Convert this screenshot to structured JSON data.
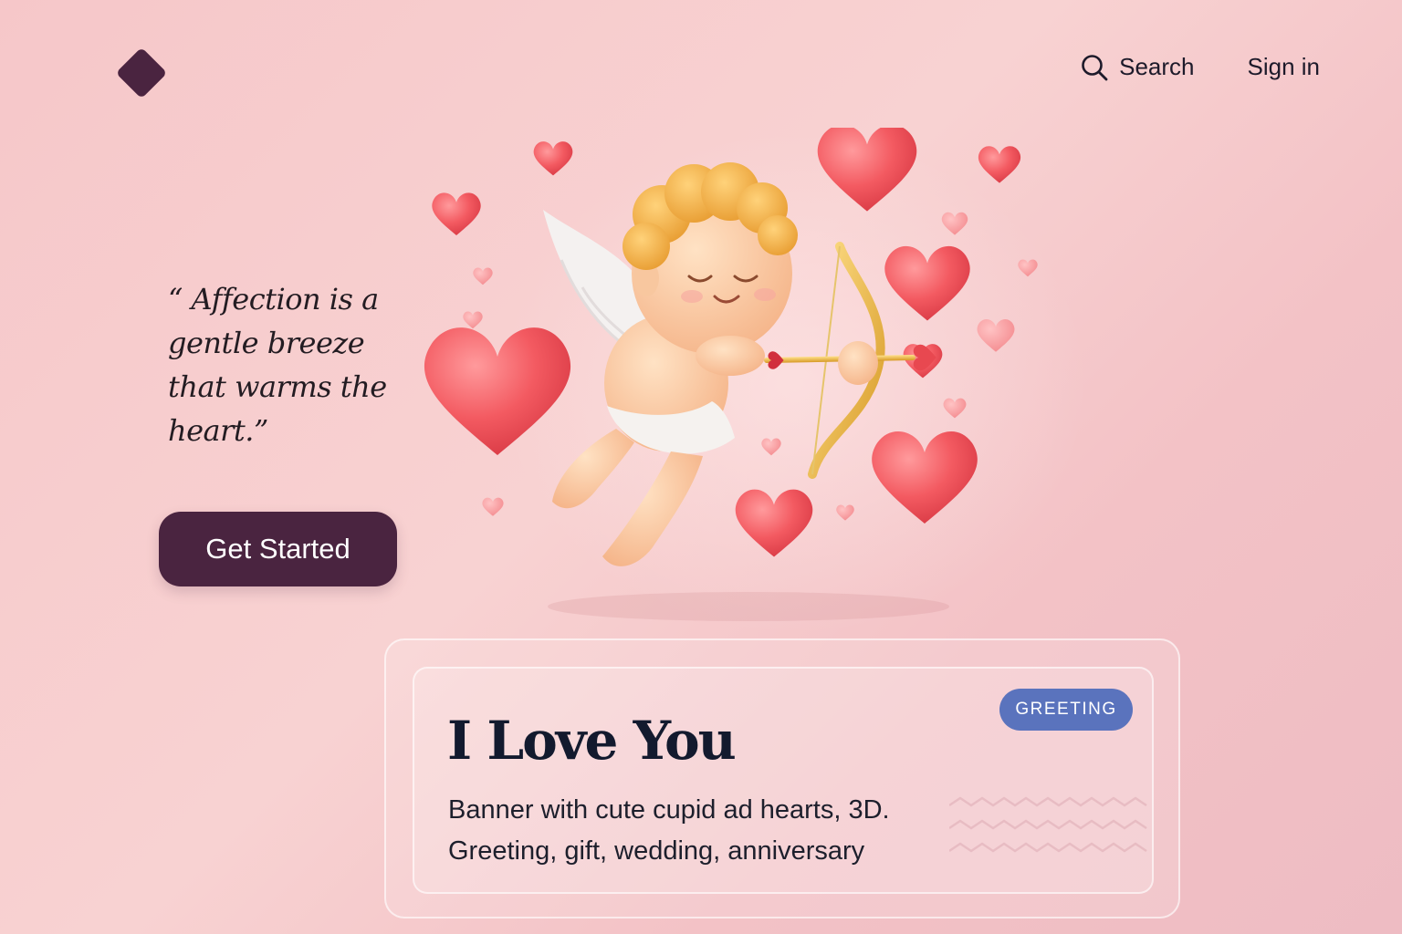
{
  "header": {
    "logo_icon": "diamond-logo-icon",
    "search_label": "Search",
    "search_icon": "search-icon",
    "signin_label": "Sign in"
  },
  "hero": {
    "quote": "“ Affection is a gentle breeze that warms the heart.”",
    "cta_label": "Get Started",
    "illustration": "cupid-with-bow-and-hearts"
  },
  "card": {
    "title": "I Love You",
    "badge": "GREETING",
    "description_line1": "Banner with cute cupid ad hearts, 3D.",
    "description_line2": "Greeting, gift, wedding, anniversary"
  },
  "colors": {
    "accent": "#4a2440",
    "badge": "#5a73bd",
    "background": "#f6c7c9",
    "heart": "#f05a5f"
  }
}
